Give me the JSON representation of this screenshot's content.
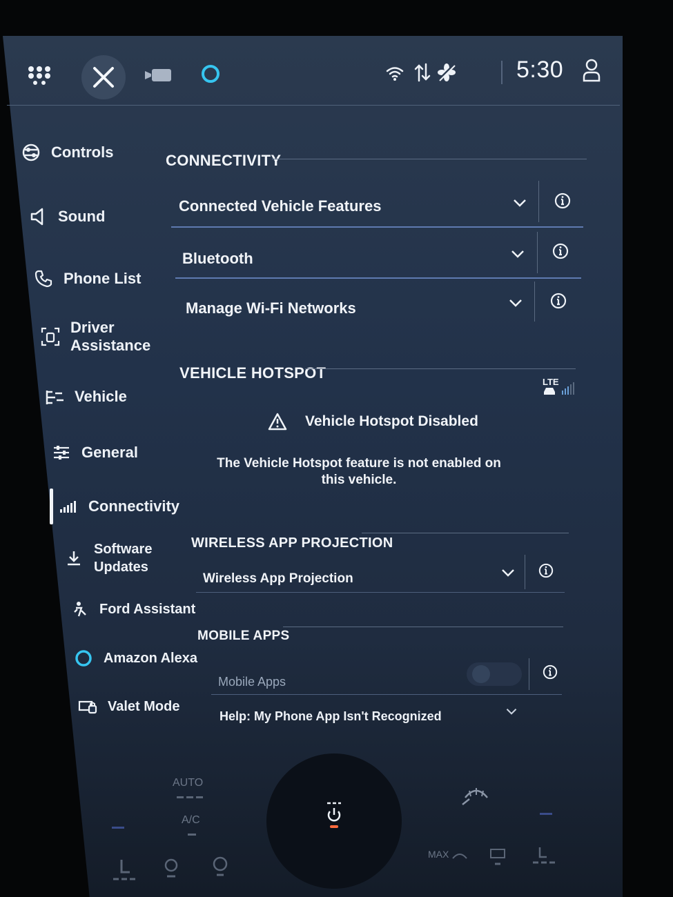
{
  "topbar": {
    "clock": "5:30",
    "icons": [
      "apps-grid-icon",
      "close-icon",
      "camera-icon",
      "alexa-icon",
      "wifi-icon",
      "data-transfer-icon",
      "fan-off-icon",
      "user-profile-icon"
    ]
  },
  "sidebar": {
    "items": [
      {
        "label": "Controls",
        "icon": "controls-icon"
      },
      {
        "label": "Sound",
        "icon": "speaker-icon"
      },
      {
        "label": "Phone List",
        "icon": "phone-icon"
      },
      {
        "label": "Driver Assistance",
        "icon": "driver-assist-icon"
      },
      {
        "label": "Vehicle",
        "icon": "vehicle-icon"
      },
      {
        "label": "General",
        "icon": "sliders-icon"
      },
      {
        "label": "Connectivity",
        "icon": "signal-bars-icon",
        "active": true
      },
      {
        "label": "Software Updates",
        "icon": "download-icon"
      },
      {
        "label": "Ford Assistant",
        "icon": "ford-assistant-icon"
      },
      {
        "label": "Amazon Alexa",
        "icon": "alexa-icon"
      },
      {
        "label": "Valet Mode",
        "icon": "valet-icon"
      }
    ]
  },
  "main": {
    "connectivity": {
      "title": "CONNECTIVITY",
      "rows": [
        {
          "label": "Connected Vehicle Features"
        },
        {
          "label": "Bluetooth"
        },
        {
          "label": "Manage Wi-Fi Networks"
        }
      ]
    },
    "hotspot": {
      "title": "VEHICLE HOTSPOT",
      "lte_label": "LTE",
      "warning": "Vehicle Hotspot Disabled",
      "message": "The Vehicle Hotspot feature is not enabled on this vehicle."
    },
    "wireless": {
      "title": "WIRELESS APP PROJECTION",
      "row_label": "Wireless App Projection"
    },
    "mobile": {
      "title": "MOBILE APPS",
      "toggle_label": "Mobile Apps",
      "toggle_on": false,
      "help_label": "Help: My Phone App Isn't Recognized"
    }
  },
  "climate": {
    "auto_label": "AUTO",
    "ac_label": "A/C",
    "max_label": "MAX"
  },
  "colors": {
    "accent": "#5f7ab0",
    "alexa": "#36c5f0",
    "power": "#ff6a3d"
  }
}
